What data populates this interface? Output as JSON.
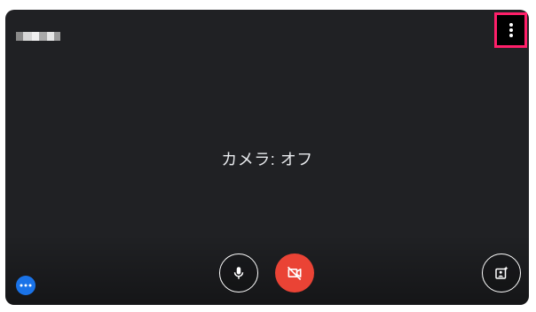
{
  "preview": {
    "status_text": "カメラ: オフ"
  },
  "icons": {
    "more_options": "more-vert-icon",
    "microphone": "mic-icon",
    "camera_off": "videocam-off-icon",
    "visual_effects": "visual-effects-icon",
    "assistant": "more-horiz-icon"
  },
  "colors": {
    "background": "#202124",
    "camera_off_button": "#ea4335",
    "assistant_button": "#1a73e8",
    "highlight": "#ff1f6a",
    "status_text": "#e8eaed"
  }
}
